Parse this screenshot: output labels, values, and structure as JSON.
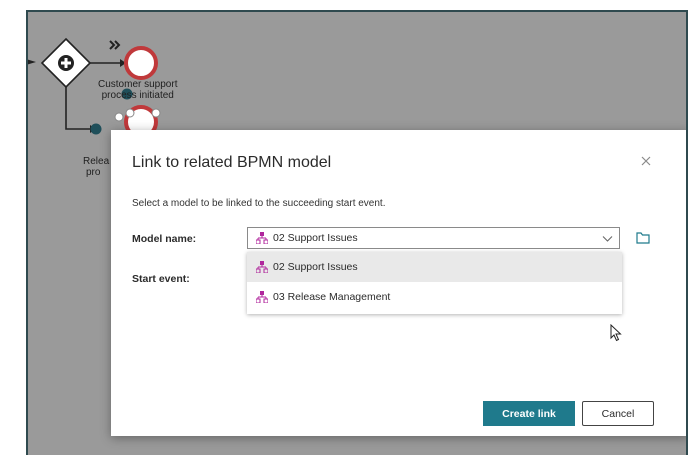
{
  "canvas": {
    "event_label": [
      "Customer support",
      "process initiated"
    ],
    "partial_label": [
      "Relea",
      "pro"
    ]
  },
  "dialog": {
    "title": "Link to related BPMN model",
    "close_icon": "close-icon",
    "description": "Select a model to be linked to the succeeding start event.",
    "model_label": "Model name:",
    "start_event_label": "Start event:",
    "model_select": {
      "value": "02 Support Issues",
      "icon": "bpmn-model-icon"
    },
    "dropdown_options": [
      {
        "label": "02 Support Issues",
        "selected": true
      },
      {
        "label": "03 Release Management",
        "selected": false
      }
    ],
    "create_label": "Create link",
    "cancel_label": "Cancel"
  },
  "colors": {
    "accent": "#1f7a8c",
    "model_icon": "#b0269c",
    "event_red": "#c0393b",
    "frame_border": "#2f4a4f"
  }
}
